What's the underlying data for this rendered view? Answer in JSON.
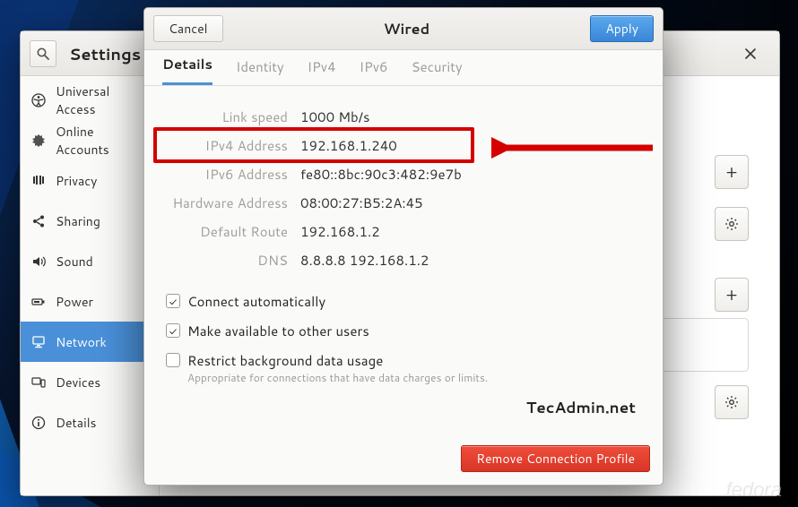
{
  "settings": {
    "title": "Settings",
    "sidebar": {
      "items": [
        {
          "label": "Universal Access",
          "icon": "universal-access-icon"
        },
        {
          "label": "Online Accounts",
          "icon": "online-accounts-icon"
        },
        {
          "label": "Privacy",
          "icon": "privacy-icon"
        },
        {
          "label": "Sharing",
          "icon": "sharing-icon"
        },
        {
          "label": "Sound",
          "icon": "sound-icon"
        },
        {
          "label": "Power",
          "icon": "power-icon"
        },
        {
          "label": "Network",
          "icon": "network-icon"
        },
        {
          "label": "Devices",
          "icon": "devices-icon"
        },
        {
          "label": "Details",
          "icon": "details-icon"
        }
      ],
      "selected_index": 6
    }
  },
  "dialog": {
    "cancel_label": "Cancel",
    "apply_label": "Apply",
    "title": "Wired",
    "tabs": {
      "items": [
        "Details",
        "Identity",
        "IPv4",
        "IPv6",
        "Security"
      ],
      "active_index": 0
    },
    "details": {
      "link_speed": {
        "label": "Link speed",
        "value": "1000 Mb/s"
      },
      "ipv4_address": {
        "label": "IPv4 Address",
        "value": "192.168.1.240"
      },
      "ipv6_address": {
        "label": "IPv6 Address",
        "value": "fe80::8bc:90c3:482:9e7b"
      },
      "hardware_address": {
        "label": "Hardware Address",
        "value": "08:00:27:B5:2A:45"
      },
      "default_route": {
        "label": "Default Route",
        "value": "192.168.1.2"
      },
      "dns": {
        "label": "DNS",
        "value": "8.8.8.8 192.168.1.2"
      }
    },
    "checks": {
      "connect_auto": {
        "label": "Connect automatically",
        "checked": true
      },
      "available_others": {
        "label": "Make available to other users",
        "checked": true
      },
      "restrict_bg": {
        "label": "Restrict background data usage",
        "checked": false,
        "hint": "Appropriate for connections that have data charges or limits."
      }
    },
    "remove_label": "Remove Connection Profile"
  },
  "brand": "TecAdmin.net",
  "distro": "fedora"
}
